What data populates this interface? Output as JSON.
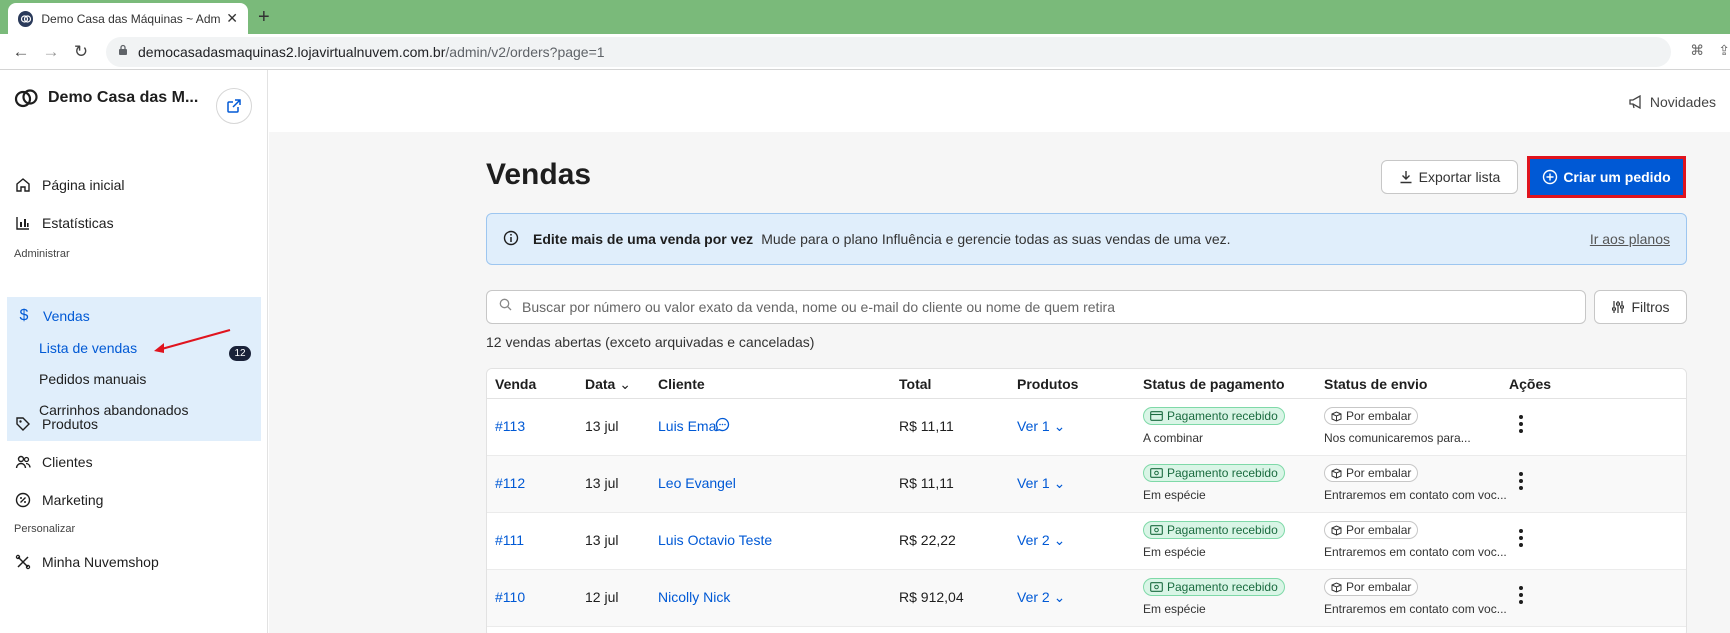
{
  "browser": {
    "tab_title": "Demo Casa das Máquinas ~ Adm",
    "url_host": "democasadasmaquinas2.lojavirtualnuvem.com.br",
    "url_path": "/admin/v2/orders?page=1"
  },
  "sidebar": {
    "store_name": "Demo Casa das M...",
    "items": [
      {
        "label": "Página inicial",
        "icon": "home-icon"
      },
      {
        "label": "Estatísticas",
        "icon": "chart-icon"
      }
    ],
    "section_admin": "Administrar",
    "sales": {
      "label": "Vendas",
      "icon": "dollar-icon",
      "sub": [
        {
          "label": "Lista de vendas",
          "badge": "12"
        },
        {
          "label": "Pedidos manuais"
        },
        {
          "label": "Carrinhos abandonados"
        }
      ]
    },
    "items2": [
      {
        "label": "Produtos",
        "icon": "tag-icon"
      },
      {
        "label": "Clientes",
        "icon": "users-icon"
      },
      {
        "label": "Marketing",
        "icon": "percent-icon"
      }
    ],
    "section_personalize": "Personalizar",
    "items3": [
      {
        "label": "Minha Nuvemshop",
        "icon": "tools-icon"
      }
    ]
  },
  "topbar": {
    "news_label": "Novidades"
  },
  "main": {
    "title": "Vendas",
    "export_label": "Exportar lista",
    "create_label": "Criar um pedido",
    "alert": {
      "strong": "Edite mais de uma venda por vez",
      "text": "Mude para o plano Influência e gerencie todas as suas vendas de uma vez.",
      "link": "Ir aos planos"
    },
    "search_placeholder": "Buscar por número ou valor exato da venda, nome ou e-mail do cliente ou nome de quem retira",
    "filter_label": "Filtros",
    "count_text": "12 vendas abertas (exceto arquivadas e canceladas)",
    "columns": [
      "Venda",
      "Data",
      "Cliente",
      "Total",
      "Produtos",
      "Status de pagamento",
      "Status de envio",
      "Ações"
    ],
    "rows": [
      {
        "id": "#113",
        "date": "13 jul",
        "client": "Luis Ema",
        "total": "R$ 11,11",
        "products": "Ver 1",
        "pay_status": "Pagamento recebido",
        "pay_sub": "A combinar",
        "ship_status": "Por embalar",
        "ship_sub": "Nos comunicaremos para..."
      },
      {
        "id": "#112",
        "date": "13 jul",
        "client": "Leo Evangel",
        "total": "R$ 11,11",
        "products": "Ver 1",
        "pay_status": "Pagamento recebido",
        "pay_sub": "Em espécie",
        "ship_status": "Por embalar",
        "ship_sub": "Entraremos em contato com voc..."
      },
      {
        "id": "#111",
        "date": "13 jul",
        "client": "Luis Octavio Teste",
        "total": "R$ 22,22",
        "products": "Ver 2",
        "pay_status": "Pagamento recebido",
        "pay_sub": "Em espécie",
        "ship_status": "Por embalar",
        "ship_sub": "Entraremos em contato com voc..."
      },
      {
        "id": "#110",
        "date": "12 jul",
        "client": "Nicolly Nick",
        "total": "R$ 912,04",
        "products": "Ver 2",
        "pay_status": "Pagamento recebido",
        "pay_sub": "Em espécie",
        "ship_status": "Por embalar",
        "ship_sub": "Entraremos em contato com voc..."
      }
    ]
  },
  "colors": {
    "accent": "#0059d5",
    "highlight": "#e0141e",
    "tabbar": "#7aba7a"
  }
}
